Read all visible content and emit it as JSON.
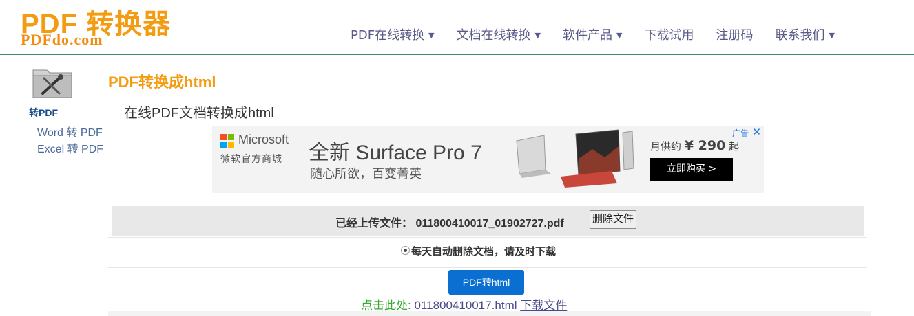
{
  "header": {
    "logo_top": "PDF 转换器",
    "logo_bottom": "PDFdo.com",
    "nav": [
      {
        "label": "PDF在线转换",
        "dropdown": true
      },
      {
        "label": "文档在线转换",
        "dropdown": true
      },
      {
        "label": "软件产品",
        "dropdown": true
      },
      {
        "label": "下载试用",
        "dropdown": false
      },
      {
        "label": "注册码",
        "dropdown": false
      },
      {
        "label": "联系我们",
        "dropdown": true
      }
    ]
  },
  "sidebar": {
    "icon": "pdf-tool-icon",
    "heading": "转PDF",
    "links": [
      "Word 转 PDF",
      "Excel 转 PDF"
    ]
  },
  "main": {
    "title": "PDF转换成html",
    "subtitle": "在线PDF文档转换成html"
  },
  "ad": {
    "brand": "Microsoft",
    "store": "微软官方商城",
    "headline": "全新 Surface Pro 7",
    "slogan": "随心所欲，百变菁英",
    "price_prefix": "月供约",
    "price": "¥ 290",
    "price_suffix": "起",
    "cta": "立即购买 >",
    "label": "广告",
    "close": "✕"
  },
  "upload": {
    "text": "已经上传文件：  011800410017_01902727.pdf",
    "delete_label": "删除文件"
  },
  "notice": "每天自动删除文档，请及时下载",
  "convert_label": "PDF转html",
  "result": {
    "label": "点击此处:",
    "filename": "011800410017.html",
    "link": "下载文件"
  },
  "colors": {
    "brand_orange": "#f39c12",
    "nav_text": "#5a5a8a",
    "button_blue": "#0a6fd1",
    "result_green": "#3aaa35"
  }
}
